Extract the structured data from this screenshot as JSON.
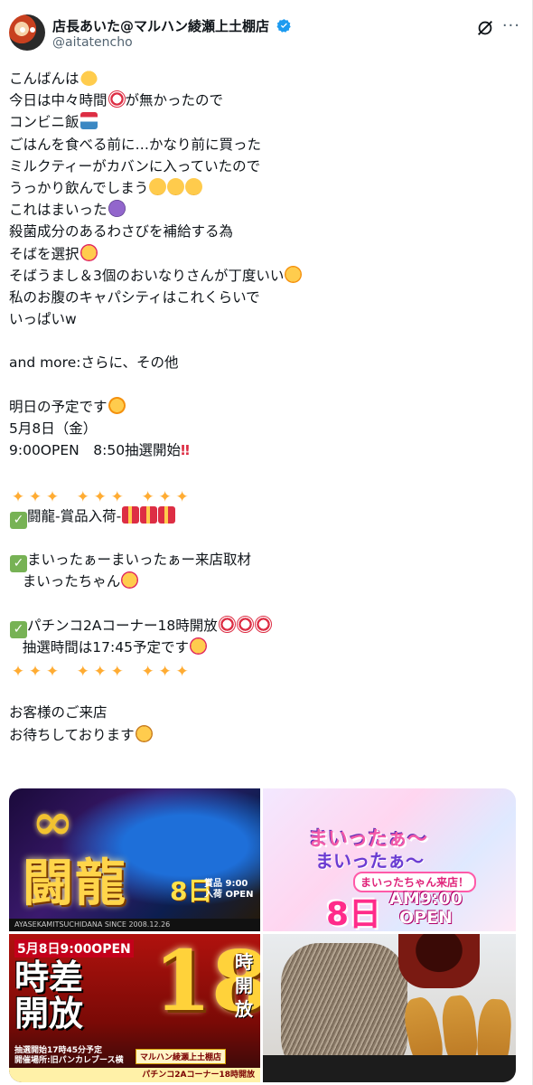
{
  "header": {
    "display_name": "店長あいた@マルハン綾瀬上土棚店",
    "handle": "@aitatencho"
  },
  "body": {
    "lines": [
      "こんばんは",
      "今日は中々時間",
      "が無かったので",
      "コンビニ飯",
      "ごはんを食べる前に…かなり前に買った",
      "ミルクティーがカバンに入っていたので",
      "うっかり飲んでしまう",
      "これはまいった",
      "殺菌成分のあるわさびを補給する為",
      "そばを選択",
      "そばうまし＆3個のおいなりさんが丁度いい",
      "私のお腹のキャパシティはこれくらいで",
      "いっぱいw",
      "and more:さらに、その他",
      "明日の予定です",
      "5月8日（金）",
      "9:00OPEN　8:50抽選開始",
      "闘龍-賞品入荷-",
      "まいったぁーまいったぁー来店取材",
      "まいったちゃん",
      "パチンコ2Aコーナー18時開放",
      "抽選時間は17:45予定です",
      "お客様のご来店",
      "お待ちしております"
    ]
  },
  "media": {
    "tile1": {
      "infinity": "∞",
      "title": "闘龍",
      "day": "8日",
      "prize": "賞品 9:00\n入荷 OPEN",
      "footer": "AYASEKAMITSUCHIDANA   SINCE 2008.12.26"
    },
    "tile2": {
      "title1": "まいったぁ〜",
      "title2": "まいったぁ〜",
      "visit": "まいったちゃん来店！",
      "day": "8日",
      "time": "AM9:00\nOPEN"
    },
    "tile3": {
      "date": "5月8日9:00OPEN",
      "title": "時差\n開放",
      "big_number": "18",
      "vertical": "時開放",
      "notes": "抽選開始17時45分予定\n開催場所:旧パンカレブース横",
      "store": "マルハン綾瀬上土棚店",
      "band": "パチンコ2Aコーナー18時開放"
    },
    "tile4": {}
  },
  "colors": {
    "accent": "#1d9bf0",
    "text": "#0f1419",
    "secondary": "#536471"
  }
}
